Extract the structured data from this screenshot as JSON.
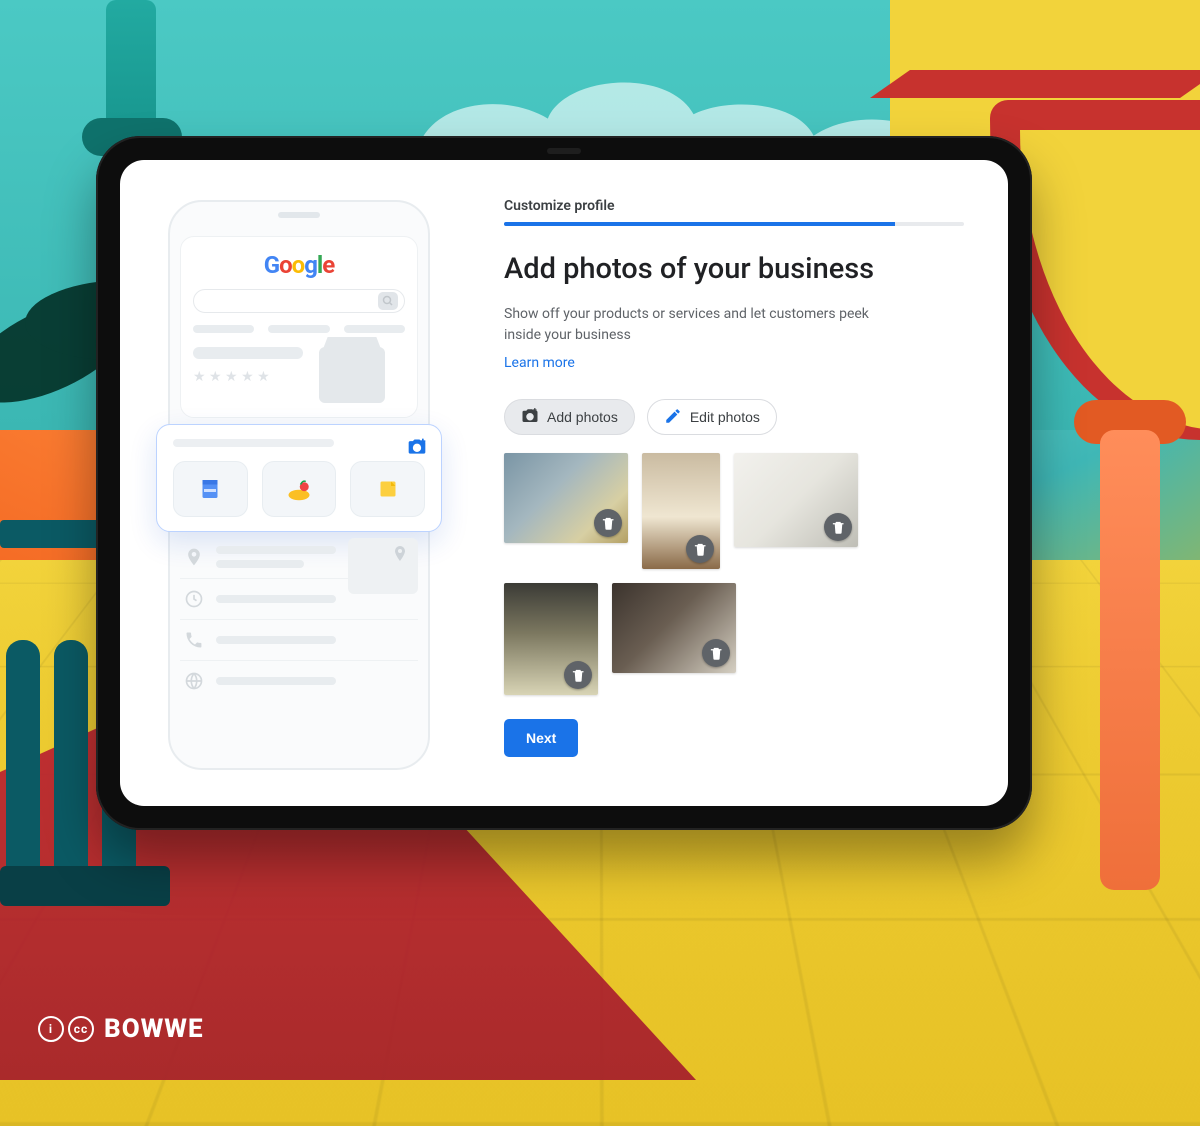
{
  "watermark": {
    "brand": "BOWWE",
    "cc1": "i",
    "cc2": "cc"
  },
  "phone": {
    "logo": {
      "l1": "G",
      "l2": "o",
      "l3": "o",
      "l4": "g",
      "l5": "l",
      "l6": "e"
    }
  },
  "panel": {
    "step_label": "Customize profile",
    "progress_percent": 85,
    "title": "Add photos of your business",
    "description": "Show off your products or services and let customers peek inside your business",
    "learn_more": "Learn more",
    "add_photos": "Add photos",
    "edit_photos": "Edit photos",
    "next": "Next",
    "photos": [
      {
        "alt": "hotel-room-breakfast"
      },
      {
        "alt": "guest-in-bathrobe"
      },
      {
        "alt": "white-pillows-bed"
      },
      {
        "alt": "flower-vase-room-service"
      },
      {
        "alt": "modern-bedroom"
      }
    ]
  }
}
